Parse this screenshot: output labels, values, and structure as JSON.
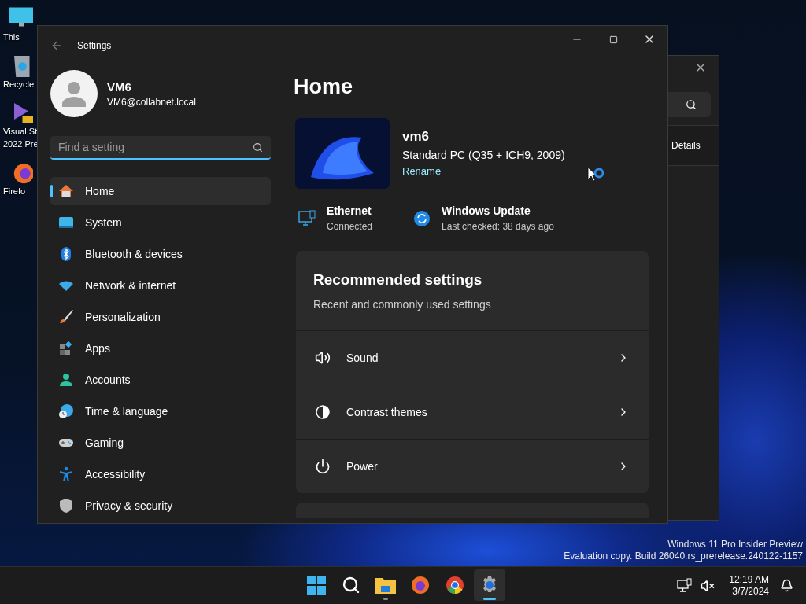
{
  "desktop": {
    "icons": [
      {
        "label_lines": [
          "This"
        ]
      },
      {
        "label_lines": [
          "Recycle"
        ]
      },
      {
        "label_lines": [
          "Visual St",
          "2022 Pre"
        ]
      },
      {
        "label_lines": [
          "Firefo"
        ]
      }
    ]
  },
  "settings": {
    "title": "Settings",
    "profile": {
      "name": "VM6",
      "email": "VM6@collabnet.local"
    },
    "search": {
      "placeholder": "Find a setting"
    },
    "nav": [
      {
        "label": "Home",
        "selected": true
      },
      {
        "label": "System",
        "selected": false
      },
      {
        "label": "Bluetooth & devices",
        "selected": false
      },
      {
        "label": "Network & internet",
        "selected": false
      },
      {
        "label": "Personalization",
        "selected": false
      },
      {
        "label": "Apps",
        "selected": false
      },
      {
        "label": "Accounts",
        "selected": false
      },
      {
        "label": "Time & language",
        "selected": false
      },
      {
        "label": "Gaming",
        "selected": false
      },
      {
        "label": "Accessibility",
        "selected": false
      },
      {
        "label": "Privacy & security",
        "selected": false
      }
    ],
    "page_title": "Home",
    "device": {
      "name": "vm6",
      "model": "Standard PC (Q35 + ICH9, 2009)",
      "rename": "Rename"
    },
    "status": [
      {
        "title": "Ethernet",
        "subtitle": "Connected"
      },
      {
        "title": "Windows Update",
        "subtitle": "Last checked: 38 days ago"
      }
    ],
    "recommended": {
      "title": "Recommended settings",
      "subtitle": "Recent and commonly used settings",
      "rows": [
        {
          "label": "Sound"
        },
        {
          "label": "Contrast themes"
        },
        {
          "label": "Power"
        }
      ]
    }
  },
  "background_window": {
    "tab_label": "Details"
  },
  "watermark": [
    "Windows 11 Pro Insider Preview",
    "Evaluation copy. Build 26040.rs_prerelease.240122-1157"
  ],
  "taskbar": {
    "apps": [
      {
        "selected": false,
        "running": false
      },
      {
        "selected": false,
        "running": false
      },
      {
        "selected": false,
        "running": true
      },
      {
        "selected": false,
        "running": false
      },
      {
        "selected": false,
        "running": false
      },
      {
        "selected": true,
        "running": true
      }
    ],
    "time": "12:19 AM",
    "date": "3/7/2024"
  }
}
